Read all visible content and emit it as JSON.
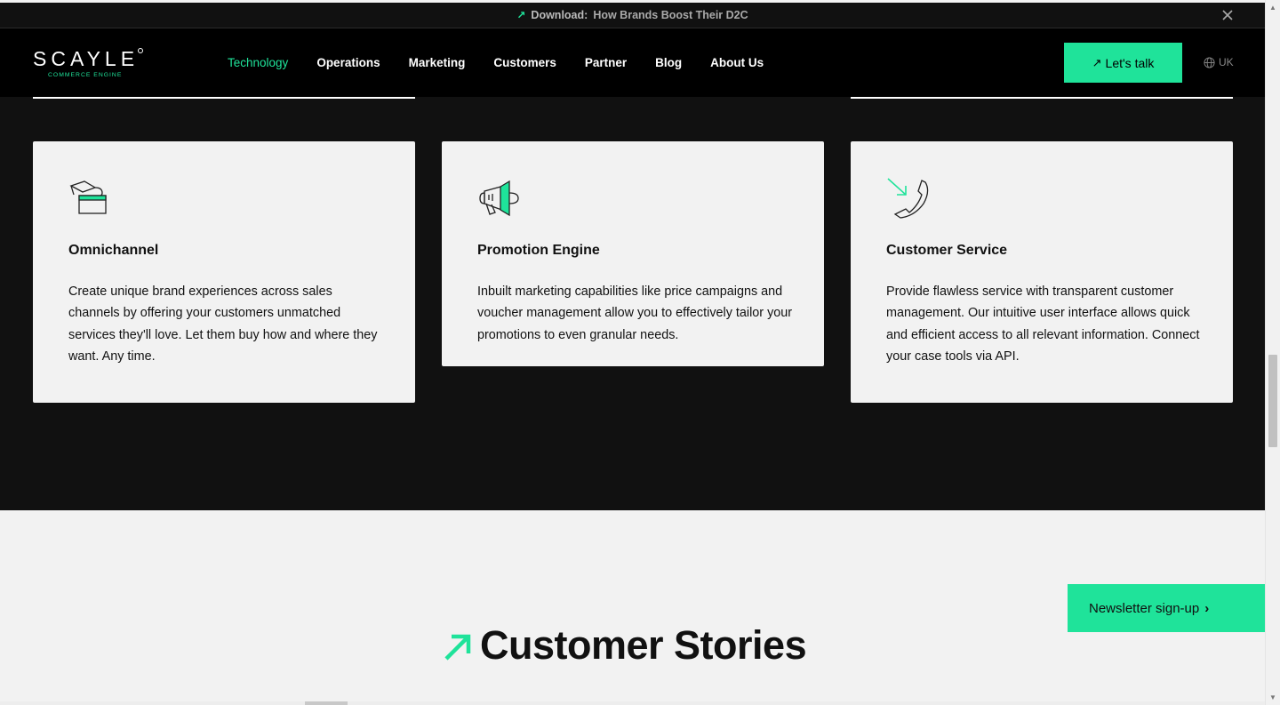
{
  "announcement": {
    "lead": "Download:",
    "text": "How Brands Boost Their D2C"
  },
  "nav": {
    "logo_word": "SCAYLE",
    "logo_sub": "COMMERCE ENGINE",
    "items": [
      {
        "label": "Technology",
        "active": true
      },
      {
        "label": "Operations"
      },
      {
        "label": "Marketing"
      },
      {
        "label": "Customers"
      },
      {
        "label": "Partner"
      },
      {
        "label": "Blog"
      },
      {
        "label": "About Us"
      }
    ],
    "cta": "Let's talk",
    "lang": "UK"
  },
  "cards": [
    {
      "icon": "omnichannel-icon",
      "title": "Omnichannel",
      "text": "Create unique brand experiences across sales channels by offering your customers unmatched services they'll love. Let them buy how and where they want. Any time."
    },
    {
      "icon": "megaphone-icon",
      "title": "Promotion Engine",
      "text": "Inbuilt marketing capabilities like price campaigns and voucher management allow you to effectively tailor your promotions to even granular needs."
    },
    {
      "icon": "phone-call-icon",
      "title": "Customer Service",
      "text": "Provide flawless service with transparent customer management. Our intuitive user interface allows quick and efficient access to all relevant information. Connect your case tools via API."
    }
  ],
  "section": {
    "title": "Customer Stories"
  },
  "newsletter": "Newsletter sign-up",
  "colors": {
    "accent": "#1fe39a",
    "dark": "#111111",
    "light": "#f2f2f2"
  }
}
